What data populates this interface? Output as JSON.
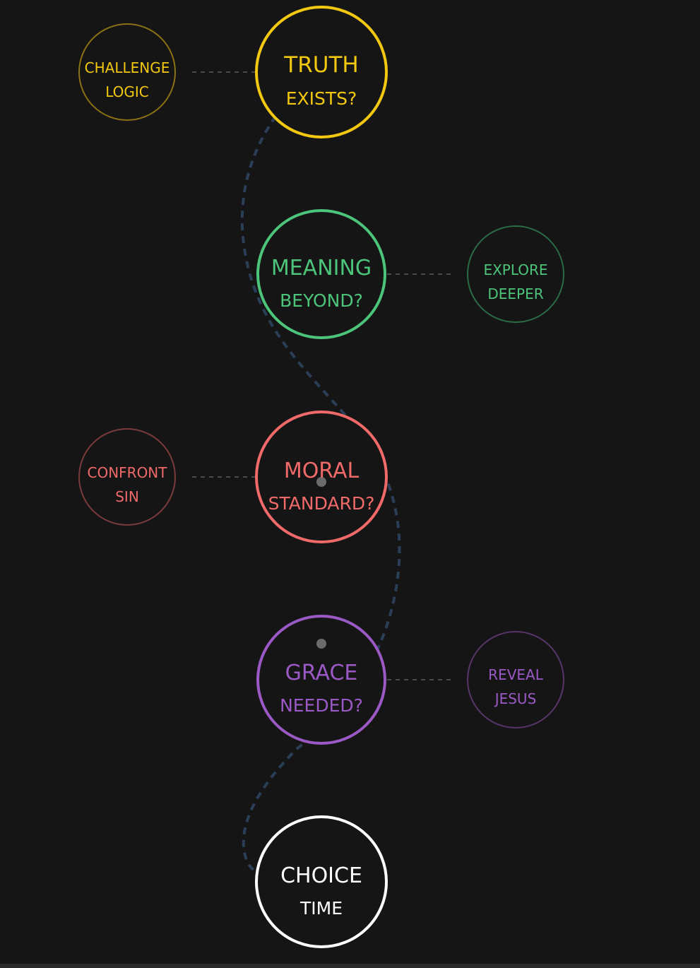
{
  "colors": {
    "background": "#151515",
    "path": "#2a3f57",
    "connector": "#4a4a4a",
    "dot": "#6b6b6b"
  },
  "nodes": [
    {
      "id": "truth",
      "line1": "TRUTH",
      "line2": "EXISTS?",
      "color": "#f2c811",
      "side_node": {
        "line1": "CHALLENGE",
        "line2": "LOGIC",
        "color": "#f2c811",
        "border": "#8a7114"
      }
    },
    {
      "id": "meaning",
      "line1": "MEANING",
      "line2": "BEYOND?",
      "color": "#4cc47a",
      "side_node": {
        "line1": "EXPLORE",
        "line2": "DEEPER",
        "color": "#4cc47a",
        "border": "#2b6b45"
      }
    },
    {
      "id": "moral",
      "line1": "MORAL",
      "line2": "STANDARD?",
      "color": "#f06a6a",
      "side_node": {
        "line1": "CONFRONT",
        "line2": "SIN",
        "color": "#f06a6a",
        "border": "#7a3b3b"
      }
    },
    {
      "id": "grace",
      "line1": "GRACE",
      "line2": "NEEDED?",
      "color": "#9b59c6",
      "side_node": {
        "line1": "REVEAL",
        "line2": "JESUS",
        "color": "#9b59c6",
        "border": "#583569"
      }
    },
    {
      "id": "choice",
      "line1": "CHOICE",
      "line2": "TIME",
      "color": "#ffffff"
    }
  ]
}
